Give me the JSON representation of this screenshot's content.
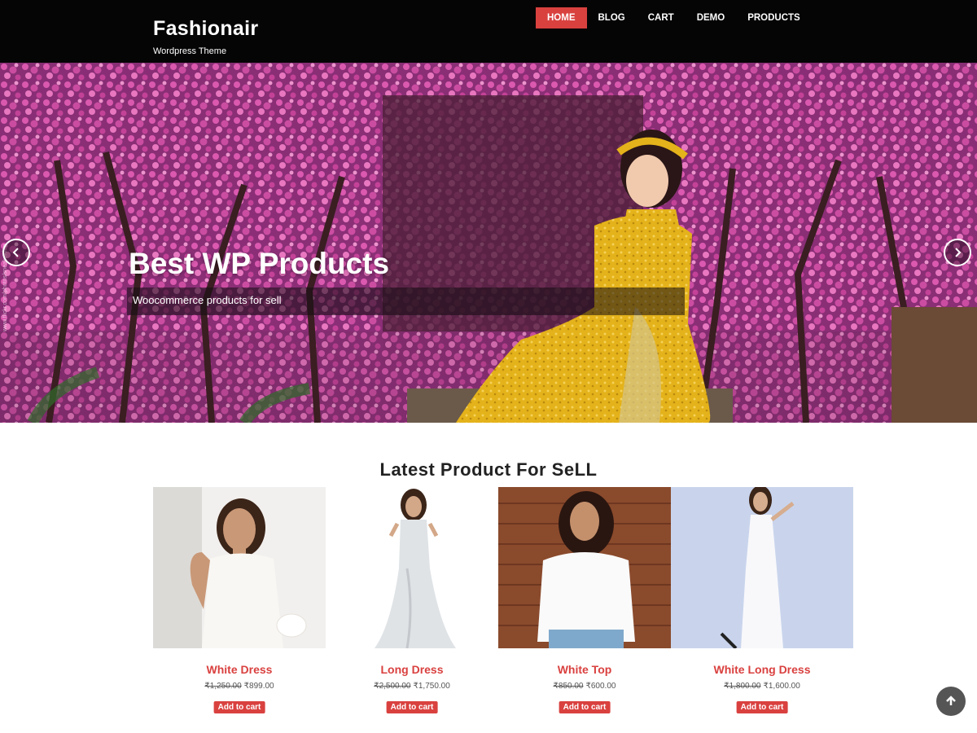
{
  "header": {
    "site_title": "Fashionair",
    "tagline": "Wordpress Theme",
    "nav": [
      {
        "label": "HOME",
        "active": true
      },
      {
        "label": "BLOG",
        "active": false
      },
      {
        "label": "CART",
        "active": false
      },
      {
        "label": "DEMO",
        "active": false
      },
      {
        "label": "PRODUCTS",
        "active": false
      }
    ]
  },
  "hero": {
    "title": "Best WP Products",
    "subtitle": "Woocommerce products for sell",
    "photo_credit": "www.flickr.com/photos/sneakerdog",
    "prev_icon": "chevron-left-icon",
    "next_icon": "chevron-right-icon"
  },
  "products_section": {
    "title": "Latest Product For SeLL",
    "items": [
      {
        "name": "White Dress",
        "old_price": "₹1,250.00",
        "price": "₹899.00",
        "button": "Add to cart"
      },
      {
        "name": "Long Dress",
        "old_price": "₹2,500.00",
        "price": "₹1,750.00",
        "button": "Add to cart"
      },
      {
        "name": "White Top",
        "old_price": "₹850.00",
        "price": "₹600.00",
        "button": "Add to cart"
      },
      {
        "name": "White Long Dress",
        "old_price": "₹1,800.00",
        "price": "₹1,600.00",
        "button": "Add to cart"
      }
    ]
  },
  "scroll_top_icon": "arrow-up-icon",
  "colors": {
    "accent": "#d9413f",
    "header_bg": "#050505",
    "blossom": "#d14fa6",
    "dress_yellow": "#e4b21a"
  }
}
